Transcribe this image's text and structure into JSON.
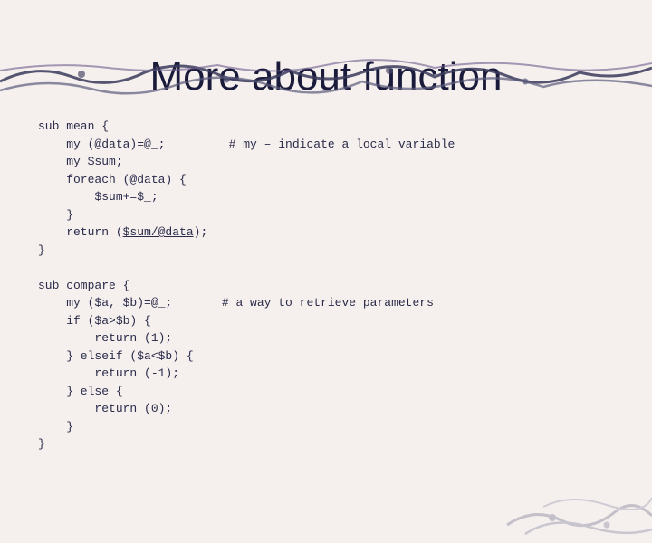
{
  "title": "More about function",
  "code": {
    "block1": {
      "line1": "sub mean {",
      "line2a": "    my (@data)=@_;",
      "line2b": "         # my – indicate a local variable",
      "line3": "    my $sum;",
      "line4": "    foreach (@data) {",
      "line5": "        $sum+=$_;",
      "line6": "    }",
      "line7a": "    return (",
      "line7b": "$sum/@data",
      "line7c": ");",
      "line8": "}"
    },
    "block2": {
      "line1": "sub compare {",
      "line2a": "    my ($a, $b)=@_;",
      "line2b": "       # a way to retrieve parameters",
      "line3": "    if ($a>$b) {",
      "line4": "        return (1);",
      "line5": "    } elseif ($a<$b) {",
      "line6": "        return (-1);",
      "line7": "    } else {",
      "line8": "        return (0);",
      "line9": "    }",
      "line10": "}"
    }
  }
}
